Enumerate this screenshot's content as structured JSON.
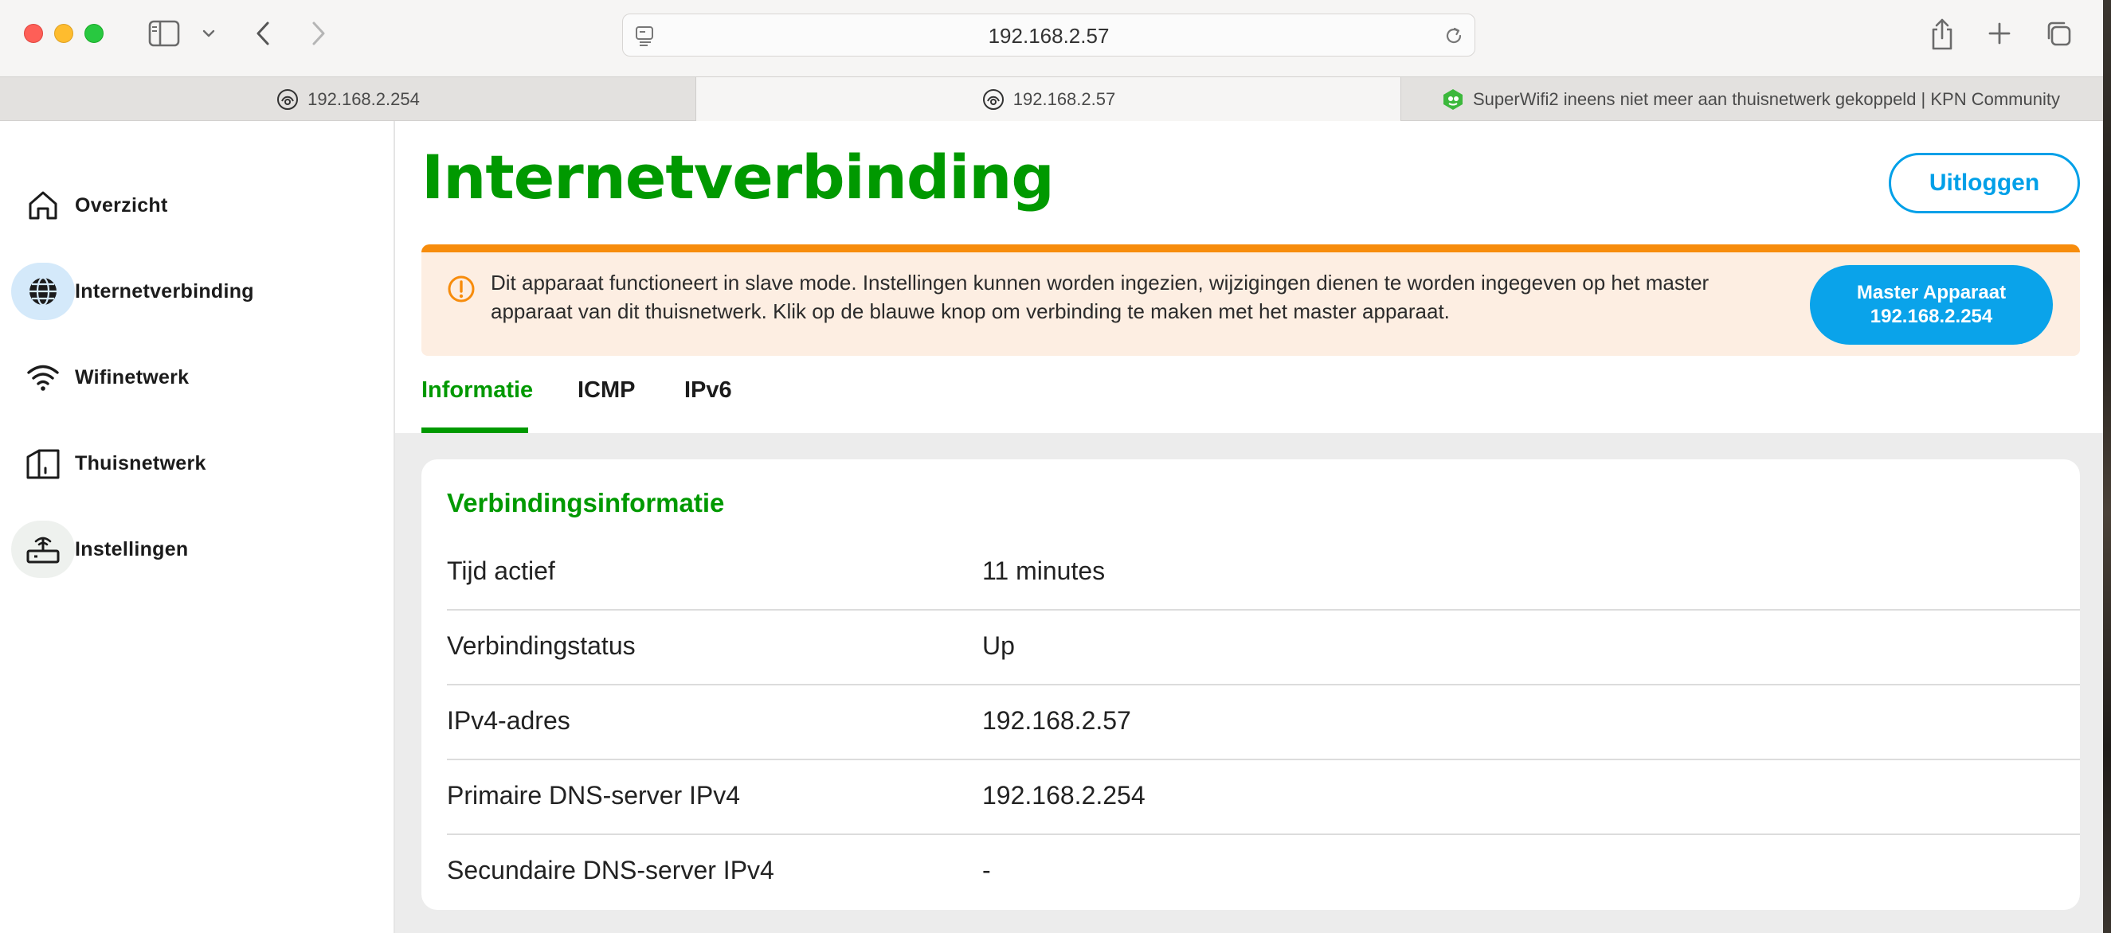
{
  "browser": {
    "url": "192.168.2.57",
    "tabs": [
      {
        "title": "192.168.2.254",
        "favicon": "kpn-router-icon",
        "active": false
      },
      {
        "title": "192.168.2.57",
        "favicon": "kpn-router-icon",
        "active": true
      },
      {
        "title": "SuperWifi2 ineens niet meer aan thuisnetwerk gekoppeld | KPN Community",
        "favicon": "kpn-community-icon",
        "active": false
      }
    ]
  },
  "sidebar": {
    "items": [
      {
        "label": "Overzicht",
        "icon": "home-icon",
        "state": "normal"
      },
      {
        "label": "Internetverbinding",
        "icon": "globe-icon",
        "state": "active"
      },
      {
        "label": "Wifinetwerk",
        "icon": "wifi-icon",
        "state": "normal"
      },
      {
        "label": "Thuisnetwerk",
        "icon": "house-network-icon",
        "state": "normal"
      },
      {
        "label": "Instellingen",
        "icon": "router-icon",
        "state": "hover"
      }
    ]
  },
  "header": {
    "title": "Internetverbinding",
    "logout_label": "Uitloggen"
  },
  "alert": {
    "message": "Dit apparaat functioneert in slave mode. Instellingen kunnen worden ingezien, wijzigingen dienen te worden ingegeven op het master apparaat van dit thuisnetwerk. Klik op de blauwe knop om verbinding te maken met het master apparaat.",
    "button_line1": "Master Apparaat",
    "button_line2": "192.168.2.254"
  },
  "subtabs": [
    {
      "label": "Informatie",
      "active": true
    },
    {
      "label": "ICMP",
      "active": false
    },
    {
      "label": "IPv6",
      "active": false
    }
  ],
  "card": {
    "title": "Verbindingsinformatie",
    "rows": [
      {
        "label": "Tijd actief",
        "value": "11 minutes"
      },
      {
        "label": "Verbindingstatus",
        "value": "Up"
      },
      {
        "label": "IPv4-adres",
        "value": "192.168.2.57"
      },
      {
        "label": "Primaire DNS-server IPv4",
        "value": "192.168.2.254"
      },
      {
        "label": "Secundaire DNS-server IPv4",
        "value": "-"
      }
    ]
  },
  "colors": {
    "brand_green": "#009900",
    "accent_blue": "#00a0e8",
    "alert_orange": "#f78c0c",
    "alert_bg": "#fdeee2"
  }
}
